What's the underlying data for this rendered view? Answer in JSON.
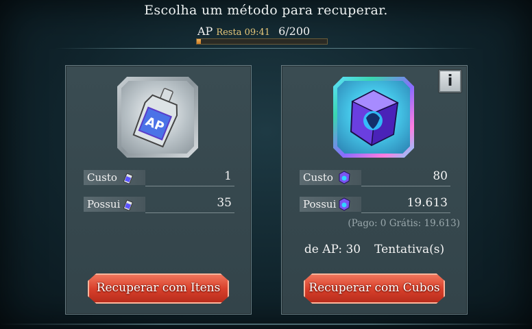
{
  "header": {
    "title": "Escolha um método para recuperar.",
    "ap_label": "AP",
    "resta_text": "Resta 09:41",
    "ap_count": "6/200",
    "ap_progress": 0.03
  },
  "items_panel": {
    "item_icon": "ap-potion-icon",
    "cost_label": "Custo",
    "cost_value": "1",
    "owned_label": "Possui",
    "owned_value": "35",
    "button_label": "Recuperar com Itens"
  },
  "cubes_panel": {
    "item_icon": "cube-icon",
    "info_icon": "info-icon",
    "info_glyph": "i",
    "cost_label": "Custo",
    "cost_value": "80",
    "owned_label": "Possui",
    "owned_value": "19.613",
    "breakdown": "(Pago: 0 Grátis: 19.613)",
    "ap_gain_text": "de AP: 30",
    "attempts_text": "Tentativa(s)",
    "button_label": "Recuperar com Cubos"
  },
  "colors": {
    "accent_red": "#d9412c",
    "resta_gold": "#e6c77a",
    "progress_orange": "#f3b35b"
  }
}
